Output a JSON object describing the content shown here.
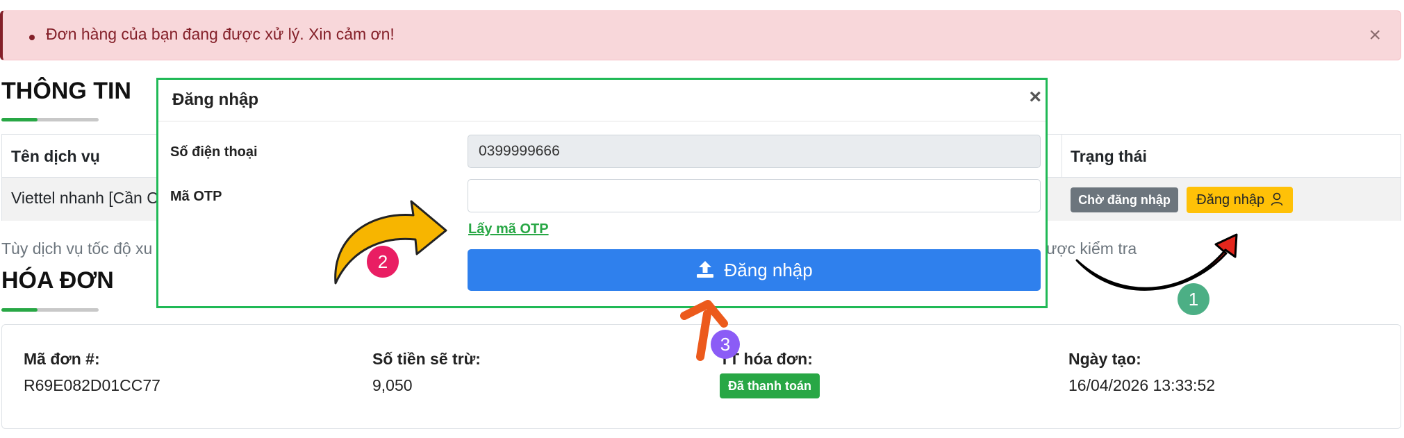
{
  "alert": {
    "message": "Đơn hàng của bạn đang được xử lý. Xin cảm ơn!",
    "close": "×"
  },
  "info": {
    "title": "THÔNG TIN",
    "headers": {
      "service": "Tên dịch vụ",
      "status": "Trạng thái"
    },
    "row": {
      "service": "Viettel nhanh [Cần C",
      "status_badge": "Chờ đăng nhập",
      "login_button": "Đăng nhập"
    },
    "note_left": "Tùy dịch vụ tốc độ xu",
    "note_right": "ược kiểm tra"
  },
  "invoice": {
    "title": "HÓA ĐƠN",
    "order_label": "Mã đơn #:",
    "order_value": "R69E082D01CC77",
    "amount_label": "Số tiền sẽ trừ:",
    "amount_value": "9,050",
    "status_label": "TT hóa đơn:",
    "status_badge": "Đã thanh toán",
    "date_label": "Ngày tạo:",
    "date_value": "16/04/2026 13:33:52"
  },
  "modal": {
    "title": "Đăng nhập",
    "close": "×",
    "phone_label": "Số điện thoại",
    "phone_value": "0399999666",
    "otp_label": "Mã OTP",
    "otp_value": "",
    "otp_link": "Lấy mã OTP",
    "submit": "Đăng nhập"
  },
  "annotations": {
    "marker1": "1",
    "marker2": "2",
    "marker3": "3",
    "colors": {
      "marker1": "#4caf85",
      "marker2": "#e91e63",
      "marker3": "#8b5cf6"
    }
  }
}
